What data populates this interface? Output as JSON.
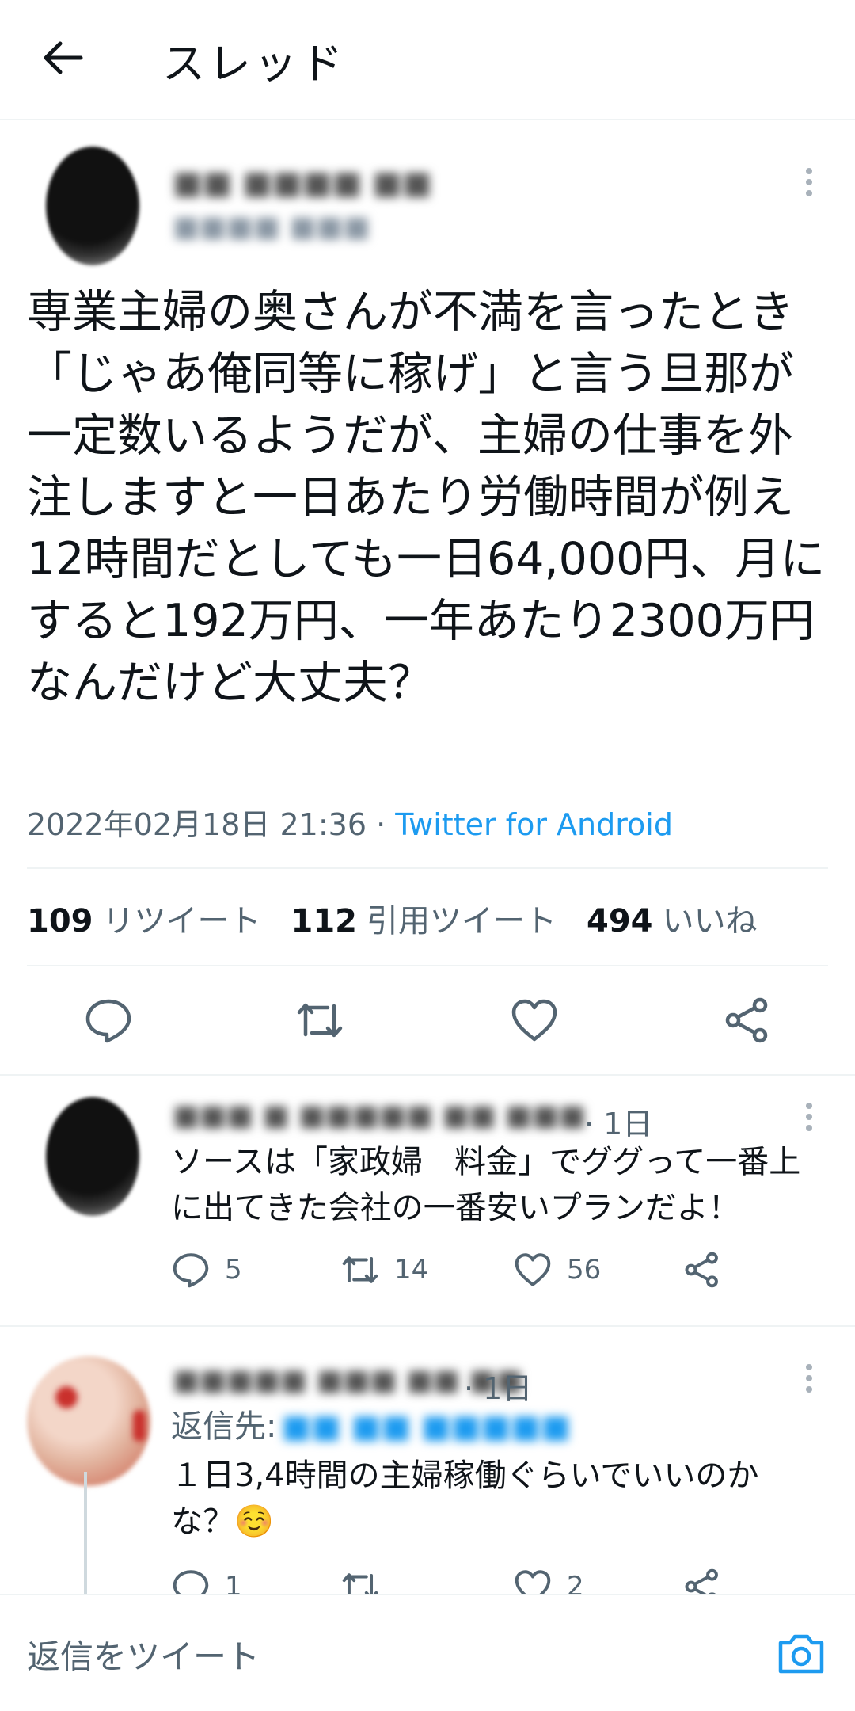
{
  "header": {
    "title": "スレッド"
  },
  "main_tweet": {
    "text": "専業主婦の奥さんが不満を言ったとき「じゃあ俺同等に稼げ」と言う旦那が一定数いるようだが、主婦の仕事を外注しますと一日あたり労働時間が例え12時間だとしても一日64,000円、月にすると192万円、一年あたり2300万円なんだけど大丈夫？",
    "timestamp": "2022年02月18日 21:36 · ",
    "source": "Twitter for Android",
    "stats": {
      "retweets": "109",
      "retweets_label": "リツイート",
      "quotes": "112",
      "quotes_label": "引用ツイート",
      "likes": "494",
      "likes_label": "いいね"
    }
  },
  "replies": [
    {
      "time": "· 1日",
      "text": "ソースは「家政婦　料金」でググって一番上に出てきた会社の一番安いプランだよ！",
      "reply_count": "5",
      "retweet_count": "14",
      "like_count": "56"
    },
    {
      "time": "· 1日",
      "reply_to_label": "返信先:",
      "text": "１日3,4時間の主婦稼働ぐらいでいいのかな？☺️",
      "reply_count": "1",
      "retweet_count": "",
      "like_count": "2"
    }
  ],
  "compose": {
    "placeholder": "返信をツイート"
  },
  "icons": [
    "back-arrow-icon",
    "more-icon",
    "reply-icon",
    "retweet-icon",
    "like-icon",
    "share-icon",
    "camera-icon"
  ],
  "colors": {
    "link": "#1d9bf0",
    "secondary": "#536471",
    "divider": "#eff3f4"
  }
}
